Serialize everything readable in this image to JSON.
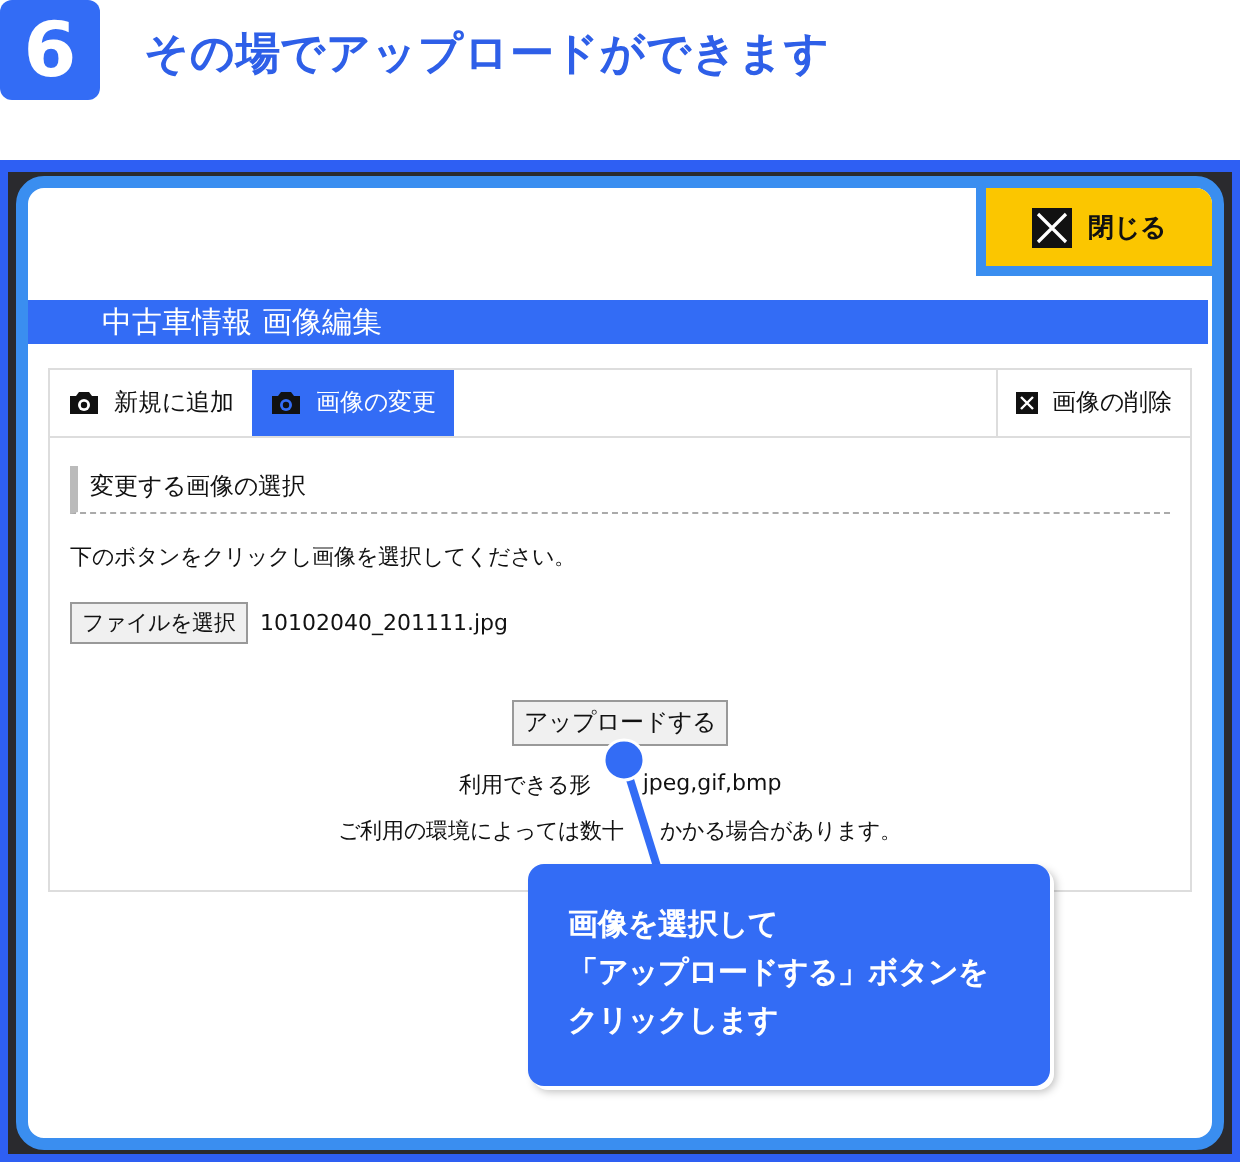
{
  "step": {
    "number": "6",
    "title": "その場でアップロードができます"
  },
  "dialog": {
    "close_button": "閉じる",
    "title": "中古車情報 画像編集",
    "tabs": [
      {
        "label": "新規に追加",
        "selected": false
      },
      {
        "label": "画像の変更",
        "selected": true
      }
    ],
    "delete_tab": "画像の削除",
    "section_heading": "変更する画像の選択",
    "instruction": "下のボタンをクリックし画像を選択してください。",
    "file_button": "ファイルを選択",
    "file_name": "10102040_201111.jpg",
    "upload_button": "アップロードする",
    "formats": [
      "利用できる形",
      "jpeg,gif,bmp"
    ],
    "note": [
      "ご利用の環境によっては数十",
      "かかる場合があります。"
    ]
  },
  "callout": {
    "lines": [
      "画像を選択して",
      "「アップロードする」ボタンを",
      "クリックします"
    ]
  }
}
